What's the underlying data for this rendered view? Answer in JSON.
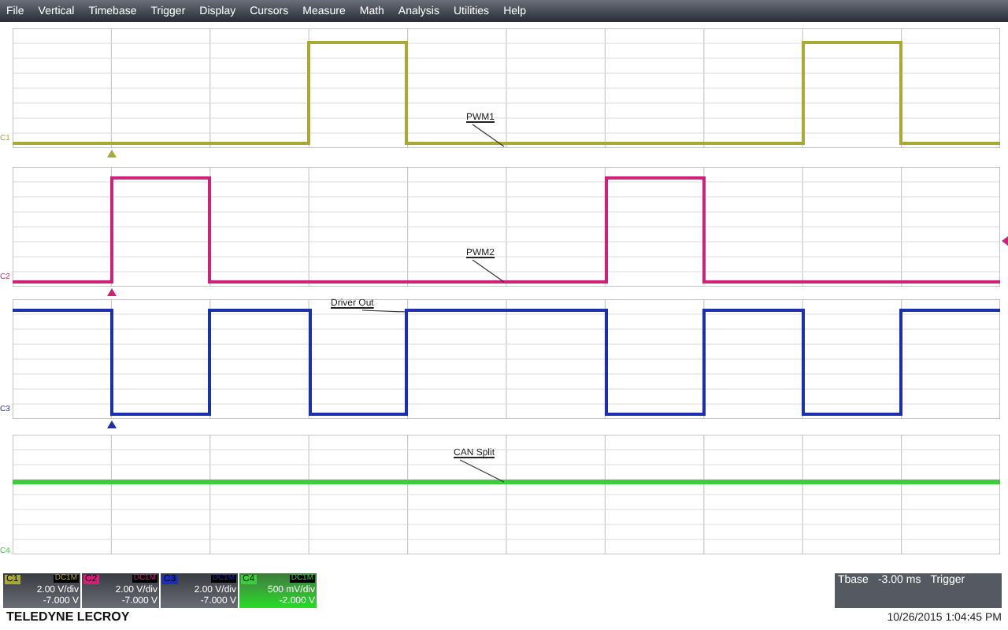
{
  "menu": [
    "File",
    "Vertical",
    "Timebase",
    "Trigger",
    "Display",
    "Cursors",
    "Measure",
    "Math",
    "Analysis",
    "Utilities",
    "Help"
  ],
  "channels": [
    {
      "label": "C1",
      "axis_label": "C1",
      "color": "#a9a935",
      "trace_label": "PWM1",
      "coupling": "DC1M",
      "scale": "2.00 V/div",
      "offset": "-7.000 V",
      "selected": false
    },
    {
      "label": "C2",
      "axis_label": "C2",
      "color": "#d0207a",
      "trace_label": "PWM2",
      "coupling": "DC1M",
      "scale": "2.00 V/div",
      "offset": "-7.000 V",
      "selected": false
    },
    {
      "label": "C3",
      "axis_label": "C3",
      "color": "#1c2fb0",
      "trace_label": "Driver Out",
      "coupling": "DC1M",
      "scale": "2.00 V/div",
      "offset": "-7.000 V",
      "selected": false
    },
    {
      "label": "C4",
      "axis_label": "C4",
      "color": "#3ccc3c",
      "trace_label": "CAN Split",
      "coupling": "DC1M",
      "scale": "500 mV/div",
      "offset": "-2.000 V",
      "selected": true
    }
  ],
  "timebase": {
    "label": "Tbase",
    "value": "-3.00 ms",
    "trigger_label": "Trigger"
  },
  "brand": "TELEDYNE LECROY",
  "timestamp": "10/26/2015 1:04:45 PM"
}
